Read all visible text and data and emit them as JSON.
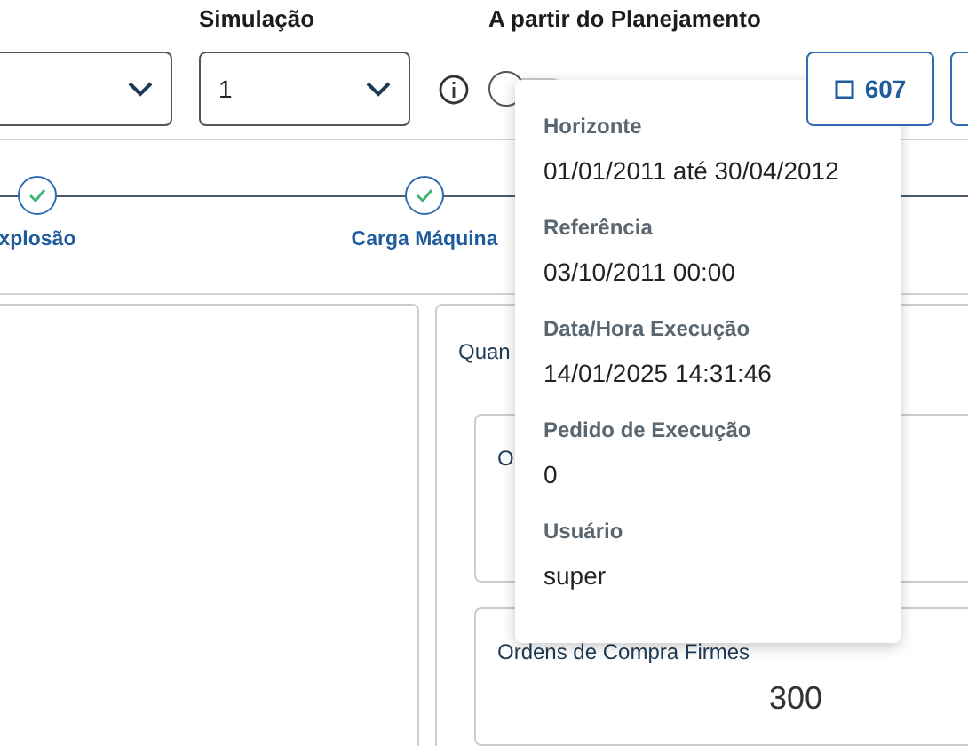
{
  "filters": {
    "simulation": {
      "label": "Simulação",
      "value": "1"
    },
    "planning": {
      "label": "A partir do Planejamento",
      "on": false
    },
    "buttons": [
      {
        "kind": "count",
        "label": "607"
      },
      {
        "kind": "partial"
      }
    ]
  },
  "steps": [
    {
      "label": "xplosão",
      "done": true
    },
    {
      "label": "Carga Máquina",
      "done": true
    }
  ],
  "right_panel": {
    "title": "Quan",
    "cards": [
      {
        "title": "O"
      },
      {
        "title": "Ordens de Compra Firmes",
        "value": "300"
      }
    ]
  },
  "popover": {
    "items": [
      {
        "label": "Horizonte",
        "value": "01/01/2011 até 30/04/2012"
      },
      {
        "label": "Referência",
        "value": "03/10/2011 00:00"
      },
      {
        "label": "Data/Hora Execução",
        "value": "14/01/2025 14:31:46"
      },
      {
        "label": "Pedido de Execução",
        "value": "0"
      },
      {
        "label": "Usuário",
        "value": "super"
      }
    ]
  }
}
